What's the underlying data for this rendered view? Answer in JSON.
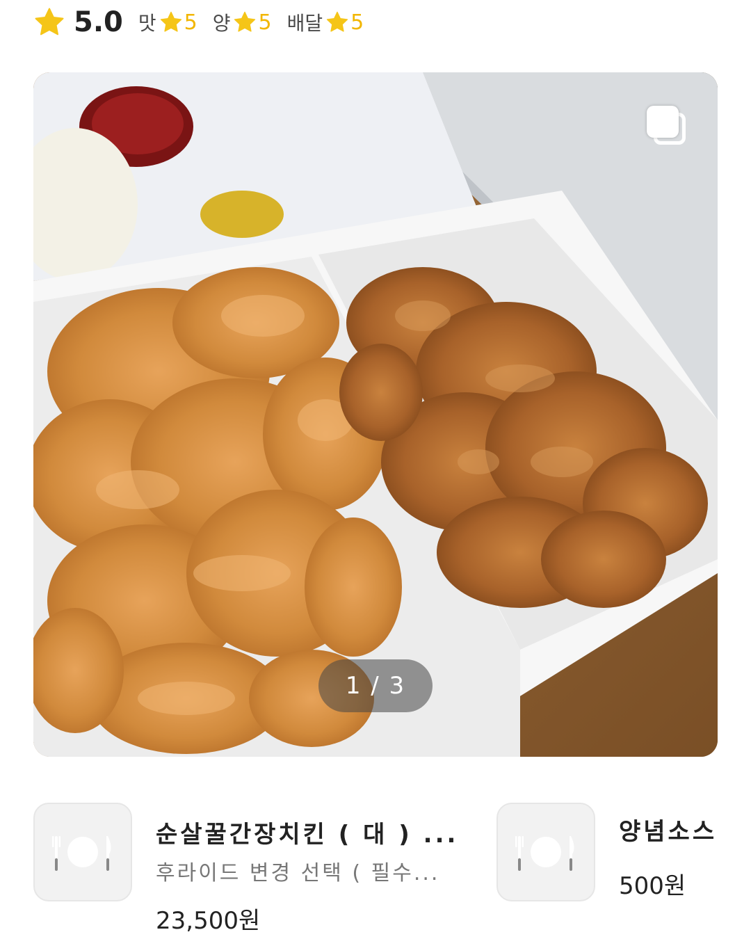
{
  "review": {
    "overall_rating": "5.0",
    "sub_ratings": [
      {
        "label": "맛",
        "value": "5"
      },
      {
        "label": "양",
        "value": "5"
      },
      {
        "label": "배달",
        "value": "5"
      }
    ],
    "star_color": "#F5C518"
  },
  "photo": {
    "indicator": "1 / 3",
    "current": 1,
    "total": 3,
    "multi_photo_icon": "multiple-photos-icon"
  },
  "menu_items": [
    {
      "name": "순살꿀간장치킨 ( 대 ) ...",
      "option": "후라이드 변경 선택 ( 필수...",
      "price": "23,500원",
      "thumbnail_icon": "utensils-plate-icon"
    },
    {
      "name": "양념소스",
      "price": "500원",
      "thumbnail_icon": "utensils-plate-icon"
    }
  ]
}
